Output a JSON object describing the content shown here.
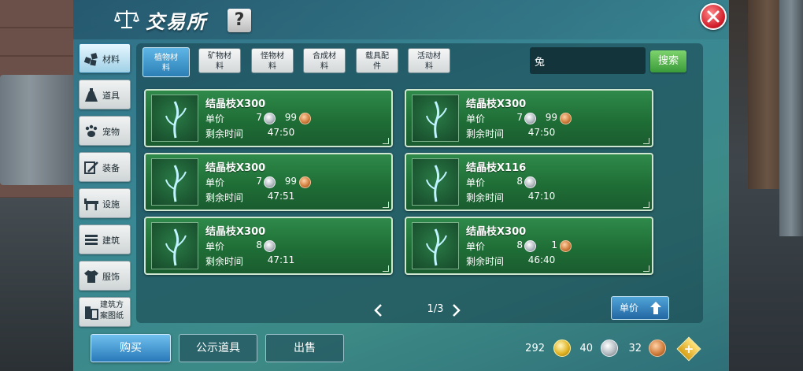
{
  "window": {
    "title": "交易所",
    "help_label": "?",
    "close_icon": "close-icon"
  },
  "sidebar": {
    "items": [
      {
        "label": "材料",
        "icon": "cube-cluster-icon",
        "active": true
      },
      {
        "label": "道具",
        "icon": "potion-icon",
        "active": false
      },
      {
        "label": "宠物",
        "icon": "paw-icon",
        "active": false
      },
      {
        "label": "装备",
        "icon": "shield-sword-icon",
        "active": false
      },
      {
        "label": "设施",
        "icon": "table-icon",
        "active": false
      },
      {
        "label": "建筑",
        "icon": "wall-icon",
        "active": false
      },
      {
        "label": "服饰",
        "icon": "shirt-icon",
        "active": false
      },
      {
        "label": "建筑方案图纸",
        "icon": "blueprint-icon",
        "active": false
      }
    ]
  },
  "tabs": [
    {
      "line1": "植物材",
      "line2": "料",
      "active": true
    },
    {
      "line1": "矿物材",
      "line2": "料",
      "active": false
    },
    {
      "line1": "怪物材",
      "line2": "料",
      "active": false
    },
    {
      "line1": "合成材",
      "line2": "料",
      "active": false
    },
    {
      "line1": "载具配",
      "line2": "件",
      "active": false
    },
    {
      "line1": "活动材",
      "line2": "料",
      "active": false
    }
  ],
  "search": {
    "value": "兔",
    "button_label": "搜索"
  },
  "listing_labels": {
    "price": "单价",
    "time": "剩余时间"
  },
  "listings": [
    {
      "name": "结晶枝X300",
      "silver": "7",
      "copper": "99",
      "time": "47:50",
      "icon": "crystal-branch-icon"
    },
    {
      "name": "结晶枝X300",
      "silver": "7",
      "copper": "99",
      "time": "47:50",
      "icon": "crystal-branch-icon"
    },
    {
      "name": "结晶枝X300",
      "silver": "7",
      "copper": "99",
      "time": "47:51",
      "icon": "crystal-branch-icon"
    },
    {
      "name": "结晶枝X116",
      "silver": "8",
      "copper": "",
      "time": "47:10",
      "icon": "crystal-branch-icon"
    },
    {
      "name": "结晶枝X300",
      "silver": "8",
      "copper": "",
      "time": "47:11",
      "icon": "crystal-branch-icon"
    },
    {
      "name": "结晶枝X300",
      "silver": "8",
      "copper": "1",
      "time": "46:40",
      "icon": "crystal-branch-icon"
    }
  ],
  "pagination": {
    "text": "1/3"
  },
  "sort": {
    "label": "单价",
    "icon": "sort-arrow-icon"
  },
  "bottom": {
    "buy_label": "购买",
    "public_label": "公示道具",
    "sell_label": "出售"
  },
  "currency": {
    "gold": "292",
    "silver": "40",
    "copper": "32"
  },
  "colors": {
    "card_green": "#1f6e36",
    "accent_blue": "#2b7fb5",
    "search_green": "#3a9b3a",
    "close_red": "#d21f2b"
  }
}
